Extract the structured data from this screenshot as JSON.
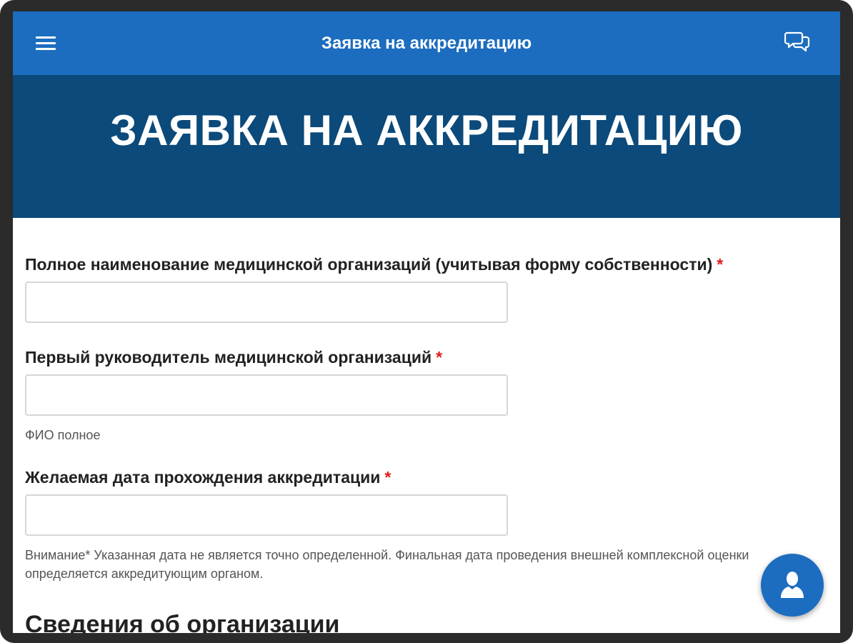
{
  "appbar": {
    "title": "Заявка на аккредитацию",
    "menu_icon": "hamburger-menu-icon",
    "chat_icon": "chat-bubbles-icon",
    "color": "#1c6dbf"
  },
  "hero": {
    "title": "ЗАЯВКА НА АККРЕДИТАЦИЮ",
    "color": "#0b4a7a"
  },
  "form": {
    "required_mark": "*",
    "fields": [
      {
        "label": "Полное наименование медицинской организаций (учитывая форму собственности)",
        "value": "",
        "placeholder": ""
      },
      {
        "label": "Первый руководитель медицинской организаций",
        "value": "",
        "placeholder": "",
        "hint": "ФИО полное"
      },
      {
        "label": "Желаемая дата прохождения аккредитации",
        "value": "",
        "placeholder": ""
      }
    ],
    "notice": "Внимание* Указанная дата не является точно определенной. Финальная дата проведения внешней комплексной оценки определяется аккредитующим органом.",
    "section_title": "Сведения об организации"
  },
  "fab": {
    "icon": "user-icon"
  }
}
